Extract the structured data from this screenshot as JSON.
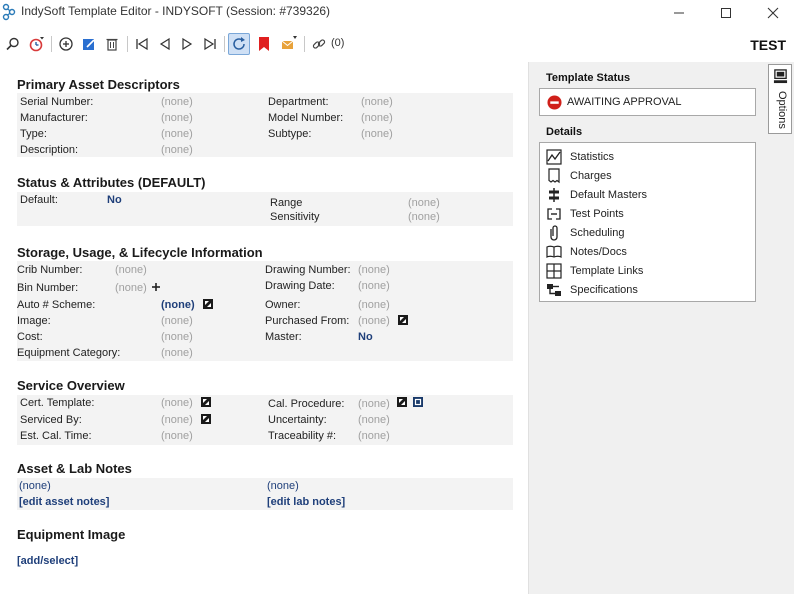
{
  "window": {
    "title": "IndySoft Template Editor - INDYSOFT (Session: #739326)"
  },
  "toolbar": {
    "link_count": "(0)",
    "environment": "TEST"
  },
  "primary": {
    "title": "Primary Asset Descriptors",
    "serial_label": "Serial Number:",
    "serial_value": "(none)",
    "manufacturer_label": "Manufacturer:",
    "manufacturer_value": "(none)",
    "type_label": "Type:",
    "type_value": "(none)",
    "description_label": "Description:",
    "description_value": "(none)",
    "department_label": "Department:",
    "department_value": "(none)",
    "model_label": "Model Number:",
    "model_value": "(none)",
    "subtype_label": "Subtype:",
    "subtype_value": "(none)"
  },
  "status_attr": {
    "title": "Status & Attributes (DEFAULT)",
    "default_label": "Default:",
    "default_value": "No",
    "range_label": "Range",
    "range_value": "(none)",
    "sensitivity_label": "Sensitivity",
    "sensitivity_value": "(none)"
  },
  "storage": {
    "title": "Storage, Usage, & Lifecycle Information",
    "crib_label": "Crib Number:",
    "crib_value": "(none)",
    "bin_label": "Bin Number:",
    "bin_value": "(none)",
    "auto_label": "Auto # Scheme:",
    "auto_value": "(none)",
    "image_label": "Image:",
    "image_value": "(none)",
    "cost_label": "Cost:",
    "cost_value": "(none)",
    "category_label": "Equipment Category:",
    "category_value": "(none)",
    "drawing_number_label": "Drawing Number:",
    "drawing_number_value": "(none)",
    "drawing_date_label": "Drawing Date:",
    "drawing_date_value": "(none)",
    "owner_label": "Owner:",
    "owner_value": "(none)",
    "purchased_label": "Purchased From:",
    "purchased_value": "(none)",
    "master_label": "Master:",
    "master_value": "No"
  },
  "service": {
    "title": "Service Overview",
    "cert_label": "Cert. Template:",
    "cert_value": "(none)",
    "serviced_label": "Serviced By:",
    "serviced_value": "(none)",
    "estcal_label": "Est. Cal. Time:",
    "estcal_value": "(none)",
    "calproc_label": "Cal. Procedure:",
    "calproc_value": "(none)",
    "uncert_label": "Uncertainty:",
    "uncert_value": "(none)",
    "trace_label": "Traceability #:",
    "trace_value": "(none)"
  },
  "notes": {
    "title": "Asset & Lab Notes",
    "asset_value": "(none)",
    "asset_link": "[edit asset notes]",
    "lab_value": "(none)",
    "lab_link": "[edit lab notes]"
  },
  "image": {
    "title": "Equipment Image",
    "add_link": "[add/select]"
  },
  "right_panel": {
    "status_title": "Template Status",
    "status_value": "AWAITING APPROVAL",
    "details_title": "Details",
    "details": [
      "Statistics",
      "Charges",
      "Default Masters",
      "Test Points",
      "Scheduling",
      "Notes/Docs",
      "Template Links",
      "Specifications"
    ],
    "options_label": "Options"
  },
  "colors": {
    "accent_link": "#1f3f7a",
    "status_stop": "#d0201a",
    "bookmark": "#e02020"
  },
  "icons": [
    "app-icon",
    "search-icon",
    "history-icon",
    "add-icon",
    "edit-icon",
    "delete-icon",
    "first-icon",
    "prev-icon",
    "next-icon",
    "last-icon",
    "refresh-icon",
    "bookmark-icon",
    "mail-icon",
    "link-icon",
    "stop-icon",
    "statistics-icon",
    "charges-icon",
    "default-masters-icon",
    "test-points-icon",
    "scheduling-icon",
    "notes-docs-icon",
    "template-links-icon",
    "specifications-icon",
    "options-icon"
  ]
}
